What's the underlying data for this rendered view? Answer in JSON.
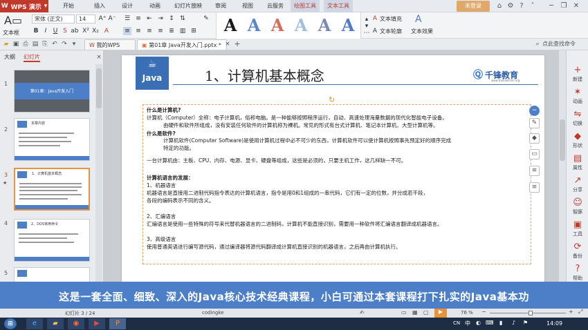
{
  "app": {
    "name": "WPS 演示",
    "login": "未登录"
  },
  "menu_tabs": [
    "开始",
    "插入",
    "设计",
    "动画",
    "幻灯片放映",
    "审阅",
    "视图",
    "云服务",
    "绘图工具",
    "文本工具"
  ],
  "ribbon": {
    "textbox_label": "文本框",
    "font_name": "宋体 (正文)",
    "font_size": "14",
    "fill_label": "文本填充",
    "outline_label": "文本轮廓",
    "effect_label": "文本效果",
    "wordart_colors": [
      "#1a1a1a",
      "#5b86c9",
      "#d86b5a",
      "#9fc0e0",
      "#7a8ab0",
      "#4f7bc7"
    ]
  },
  "doc_tabs": {
    "my_wps": "我的WPS",
    "current": "第01章 Java开发入门.pptx *"
  },
  "search": {
    "placeholder": "点此查找命令"
  },
  "left_pane": {
    "tabs": [
      "大纲",
      "幻灯片"
    ],
    "slides": [
      {
        "num": "1",
        "title": "第01章：Java开发入门"
      },
      {
        "num": "2",
        "title": "本章内容"
      },
      {
        "num": "3",
        "title": "1、计算机基本概念"
      },
      {
        "num": "4",
        "title": "2、DOS常用命令"
      },
      {
        "num": "5",
        "title": ""
      }
    ]
  },
  "slide": {
    "logo_text": "Java",
    "title": "1、计算机基本概念",
    "brand": "千锋教育",
    "brand_url": "www.mobiletrain.org",
    "lines": [
      {
        "text": "什么是计算机?",
        "bold": true
      },
      {
        "text": "计算机（Computer）全称：电子计算机，俗称电脑。是一种能够按照程序运行，自动、高速处理海量数据的现代化智能电子设备。",
        "bold": false
      },
      {
        "text": "由硬件和软件所组成，没有安装任何软件的计算机称为裸机。常见的形式有台式计算机、笔记本计算机、大型计算机等。",
        "bold": false,
        "indent": 1
      },
      {
        "text": "什么是软件?",
        "bold": true
      },
      {
        "text": "计算机软件(Computer Software)是使用计算机过程中必不可少的东西，计算机软件可以使计算机按照事先预定好的顺序完成",
        "bold": false,
        "indent": 2
      },
      {
        "text": "特定的功能。",
        "bold": false,
        "indent": 2
      },
      {
        "text": "一台计算机由：主板、CPU、内存、电源、显卡、硬盘等组成，这些是必须的，只要主机工作，这几样缺一不可。",
        "bold": false
      },
      {
        "text": "计算机语言的发展：",
        "bold": true
      },
      {
        "text": "1、机器语言",
        "bold": false
      },
      {
        "text": "机器语言是直接用二进制代码指令表达的计算机语言，指令是用0和1组成的一串代码，它们有一定的位数，并分成若干段，",
        "bold": false
      },
      {
        "text": "各段的编码表示不同的含义。",
        "bold": false
      },
      {
        "text": "2、汇编语言",
        "bold": false
      },
      {
        "text": "汇编语言是使用一些特殊的符号来代替机器语言的二进制码，计算机不能直接识别，需要用一种软件将汇编语言翻译成机器语言。",
        "bold": false
      },
      {
        "text": "3、高级语言",
        "bold": false
      },
      {
        "text": "使用普通英语进行编写源代码，通过编译器将源代码翻译成计算机直接识别的机器语言，之后再由计算机执行。",
        "bold": false
      }
    ]
  },
  "right_bar": [
    {
      "label": "新建",
      "icon": "plus-icon"
    },
    {
      "label": "动画",
      "icon": "animation-icon"
    },
    {
      "label": "切换",
      "icon": "transition-icon"
    },
    {
      "label": "形状",
      "icon": "shape-icon"
    },
    {
      "label": "属性",
      "icon": "property-icon"
    },
    {
      "label": "分享",
      "icon": "share-icon"
    },
    {
      "label": "智豚",
      "icon": "robot-icon"
    },
    {
      "label": "工具",
      "icon": "toolbox-icon"
    },
    {
      "label": "备份",
      "icon": "backup-icon"
    },
    {
      "label": "帮助",
      "icon": "help-icon"
    }
  ],
  "banner": {
    "text": "这是一套全面、细致、深入的Java核心技术经典课程，小白可通过本套课程打下扎实的Java基本功"
  },
  "status": {
    "slide_info": "幻灯片 3 / 24",
    "theme": "codingke",
    "zoom": "76 %"
  },
  "taskbar": {
    "time": "14:09",
    "lang": "CN"
  }
}
